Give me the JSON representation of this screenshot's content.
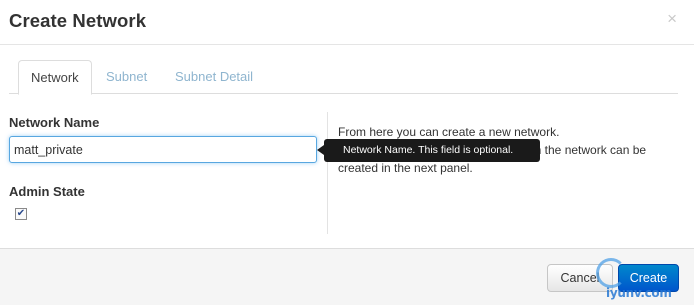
{
  "modal": {
    "title": "Create Network",
    "close_glyph": "×"
  },
  "tabs": [
    {
      "label": "Network",
      "active": true
    },
    {
      "label": "Subnet",
      "active": false
    },
    {
      "label": "Subnet Detail",
      "active": false
    }
  ],
  "form": {
    "network_name_label": "Network Name",
    "network_name_value": "matt_private",
    "admin_state_label": "Admin State",
    "admin_state_checked": true,
    "checkbox_glyph": "✔"
  },
  "help": {
    "line1": "From here you can create a new network.",
    "line2": "with the network can be",
    "line3": "created in the next panel."
  },
  "tooltip": {
    "text": "Network Name. This field is optional."
  },
  "footer": {
    "cancel_label": "Cancel",
    "create_label": "Create"
  },
  "watermark": {
    "text": "iyunv.com"
  },
  "colors": {
    "primary_button": "#0074cc",
    "tab_inactive": "#8fb5cf",
    "focus_border": "#58a7e0",
    "tooltip_bg": "#1a1a1a"
  }
}
